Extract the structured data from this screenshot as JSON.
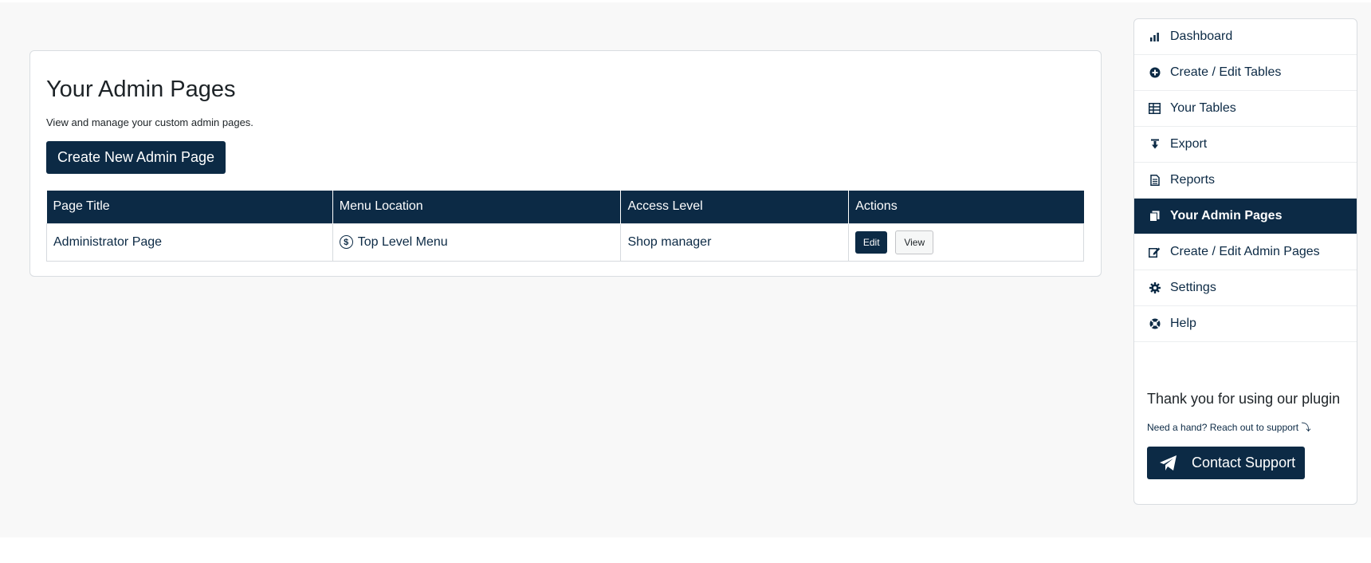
{
  "main": {
    "title": "Your Admin Pages",
    "description": "View and manage your custom admin pages.",
    "create_button": "Create New Admin Page",
    "table": {
      "headers": [
        "Page Title",
        "Menu Location",
        "Access Level",
        "Actions"
      ],
      "rows": [
        {
          "page_title": "Administrator Page",
          "menu_location": "Top Level Menu",
          "menu_icon": "dollar-circle-icon",
          "access_level": "Shop manager",
          "edit_label": "Edit",
          "view_label": "View"
        }
      ]
    }
  },
  "sidebar": {
    "items": [
      {
        "label": "Dashboard",
        "icon": "bar-chart-icon"
      },
      {
        "label": "Create / Edit Tables",
        "icon": "plus-circle-icon"
      },
      {
        "label": "Your Tables",
        "icon": "table-icon"
      },
      {
        "label": "Export",
        "icon": "download-icon"
      },
      {
        "label": "Reports",
        "icon": "document-icon"
      },
      {
        "label": "Your Admin Pages",
        "icon": "pages-icon",
        "active": true
      },
      {
        "label": "Create / Edit Admin Pages",
        "icon": "edit-page-icon"
      },
      {
        "label": "Settings",
        "icon": "gear-icon"
      },
      {
        "label": "Help",
        "icon": "lifebuoy-icon"
      }
    ],
    "thanks": "Thank you for using our plugin",
    "need_hand": "Need a hand? Reach out to support ⤵",
    "support_button": "Contact Support"
  },
  "colors": {
    "primary": "#0c2a45",
    "background": "#f8f8f8",
    "card": "#ffffff"
  }
}
